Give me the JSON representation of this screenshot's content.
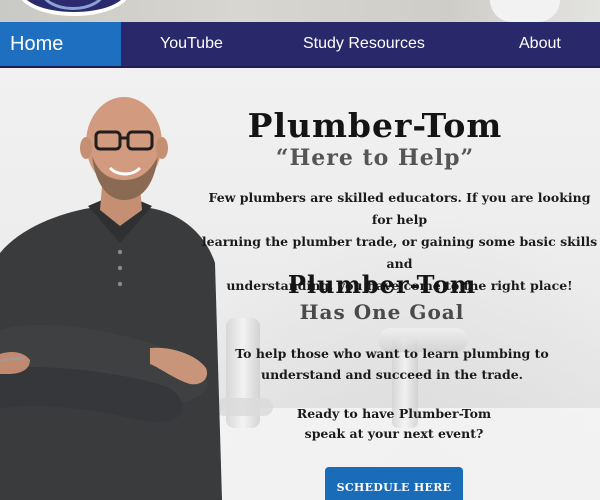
{
  "nav": {
    "home_label": "Home",
    "youtube_label": "YouTube",
    "study_label": "Study Resources",
    "about_label": "About"
  },
  "hero": {
    "title": "Plumber-Tom",
    "subtitle": "“Here to Help”",
    "intro_line1": "Few plumbers are skilled educators. If you are looking for help",
    "intro_line2": "learning the plumber trade, or gaining some basic skills and",
    "intro_line3": "understanding, you have come to the right place!",
    "title2": "Plumber-Tom",
    "subtitle2": "Has One Goal",
    "goal_line1": "To help those who want to learn plumbing to",
    "goal_line2": "understand and succeed in the trade.",
    "cta_line1": "Ready to have Plumber-Tom",
    "cta_line2": "speak at your next event?",
    "button_label": "SCHEDULE HERE"
  },
  "colors": {
    "nav_bg": "#29286a",
    "nav_active": "#1f6fc0",
    "button_bg": "#1a6cb8"
  }
}
